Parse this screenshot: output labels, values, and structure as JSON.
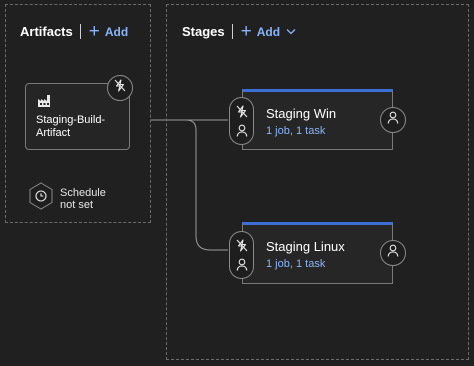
{
  "artifacts": {
    "title": "Artifacts",
    "add_label": "Add",
    "card": {
      "name": "Staging-Build-Artifact",
      "trigger_icon": "lightning-icon",
      "build_icon": "factory-icon"
    }
  },
  "schedule": {
    "line1": "Schedule",
    "line2": "not set",
    "icon": "clock-icon"
  },
  "stages": {
    "title": "Stages",
    "add_label": "Add",
    "items": [
      {
        "name": "Staging Win",
        "summary": "1 job, 1 task"
      },
      {
        "name": "Staging Linux",
        "summary": "1 job, 1 task"
      }
    ]
  },
  "colors": {
    "accent": "#3b6fd4",
    "link": "#8ab4f8",
    "background": "#202020"
  }
}
